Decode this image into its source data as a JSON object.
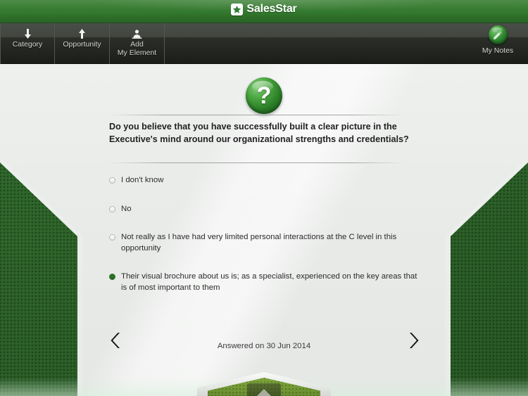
{
  "header": {
    "brand": "SalesStar",
    "logo_icon": "star-logo-icon"
  },
  "toolbar": {
    "items": [
      {
        "label": "Category",
        "icon": "arrow-down-icon"
      },
      {
        "label": "Opportunity",
        "icon": "arrow-up-icon"
      },
      {
        "label": "Add\nMy Element",
        "label_line1": "Add",
        "label_line2": "My Element",
        "icon": "person-add-icon"
      }
    ],
    "notes": {
      "label": "My Notes",
      "icon": "note-orb-icon"
    }
  },
  "main": {
    "question_icon": "question-mark-orb-icon",
    "question_mark": "?",
    "question": "Do you believe that you have successfully built a clear picture in the Executive's mind around our organizational strengths and credentials?",
    "options": [
      {
        "label": "I don't know",
        "selected": false
      },
      {
        "label": "No",
        "selected": false
      },
      {
        "label": "Not really as I have had very limited personal interactions at the C level in this opportunity",
        "selected": false
      },
      {
        "label": "Their visual brochure about us is; as a specialist, experienced on the key areas that is of most important to them",
        "selected": true
      }
    ],
    "answered_text": "Answered on 30 Jun 2014",
    "prev_label": "‹",
    "next_label": "›",
    "prev_icon": "chevron-left-icon",
    "next_icon": "chevron-right-icon"
  },
  "dock": {
    "icon": "triangle-up-icon"
  },
  "colors": {
    "header_green": "#337a2f",
    "accent_green": "#2e7326",
    "toolbar_dark": "#232520",
    "panel_gray": "#e9ebe9",
    "backdrop_green": "#2c6228"
  }
}
